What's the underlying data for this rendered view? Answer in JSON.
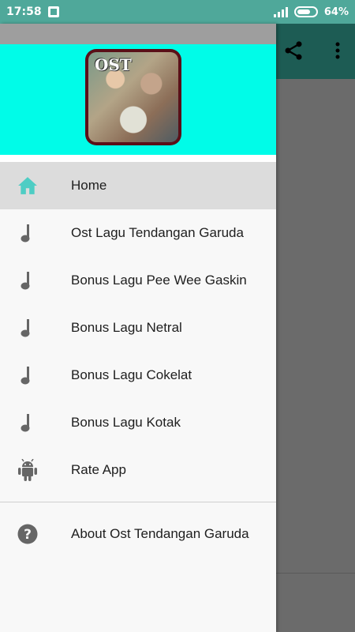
{
  "status_bar": {
    "time": "17:58",
    "battery": "64%"
  },
  "colors": {
    "status_bar": "#4fa89a",
    "toolbar": "#1d5c54",
    "drawer_header": "#00fce8",
    "active_item": "#dcdcdc",
    "home_icon": "#4ecdc4"
  },
  "drawer": {
    "header_logo_text": "OST",
    "menu": [
      {
        "label": "Home",
        "icon": "home-icon",
        "active": true
      },
      {
        "label": "Ost Lagu Tendangan Garuda",
        "icon": "music-note-icon"
      },
      {
        "label": "Bonus Lagu Pee Wee Gaskin",
        "icon": "music-note-icon"
      },
      {
        "label": "Bonus Lagu Netral",
        "icon": "music-note-icon"
      },
      {
        "label": "Bonus Lagu Cokelat",
        "icon": "music-note-icon"
      },
      {
        "label": "Bonus Lagu Kotak",
        "icon": "music-note-icon"
      },
      {
        "label": "Rate App",
        "icon": "android-icon"
      }
    ],
    "footer_menu": [
      {
        "label": "About Ost Tendangan Garuda",
        "icon": "help-icon"
      }
    ]
  }
}
